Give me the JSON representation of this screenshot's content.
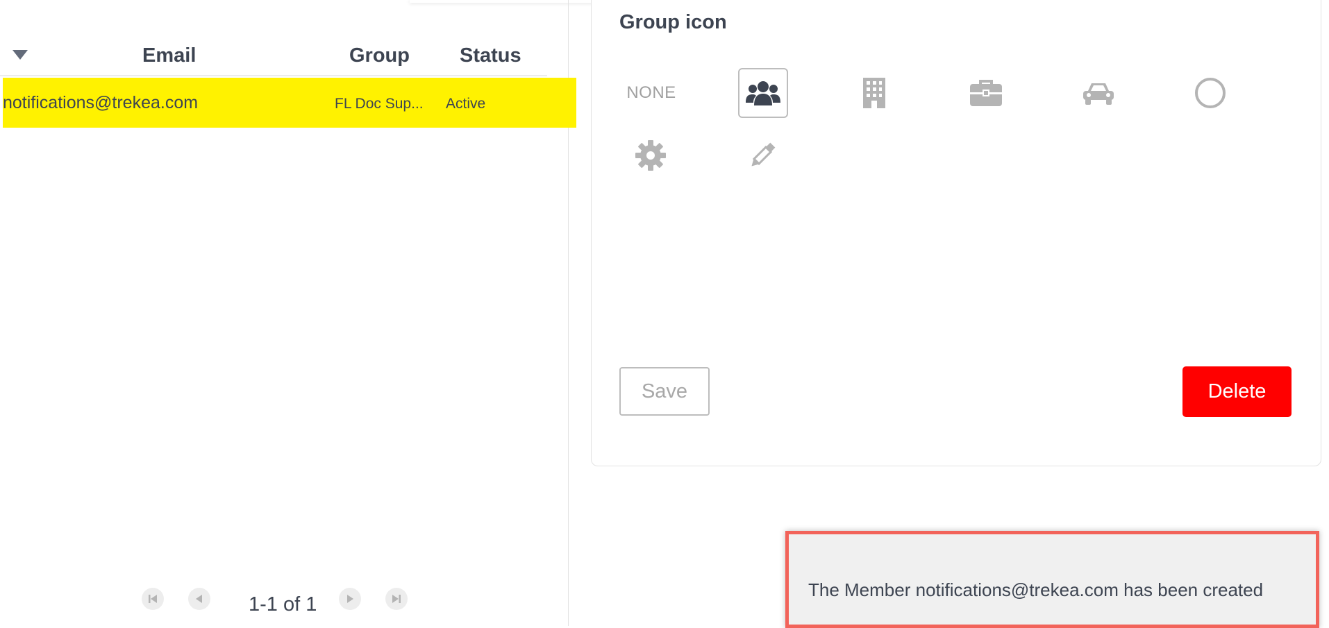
{
  "table": {
    "columns": [
      "Email",
      "Group",
      "Status"
    ],
    "rows": [
      {
        "email": "notifications@trekea.com",
        "group": "FL Doc Sup...",
        "status": "Active"
      }
    ],
    "highlight_color": "#fff200"
  },
  "pagination": {
    "text": "1-1 of 1",
    "icons": [
      "first-page-icon",
      "previous-page-icon",
      "next-page-icon",
      "last-page-icon"
    ]
  },
  "group_icon": {
    "title": "Group icon",
    "none_label": "NONE",
    "options": [
      "none",
      "users-icon",
      "building-icon",
      "briefcase-icon",
      "car-icon",
      "circle-icon",
      "gear-icon",
      "pencil-icon"
    ],
    "selected": "users-icon"
  },
  "buttons": {
    "save_label": "Save",
    "delete_label": "Delete",
    "delete_color": "#ff0000"
  },
  "toast": {
    "message": "The Member notifications@trekea.com has been created",
    "border_color": "#f2635a"
  }
}
